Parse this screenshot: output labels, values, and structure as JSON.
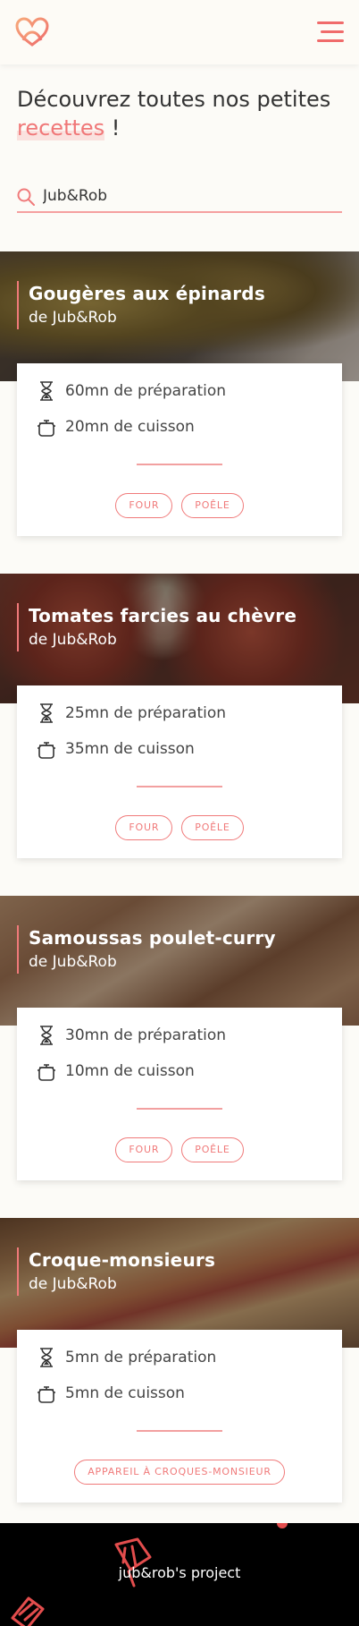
{
  "header": {
    "logo": "heart-logo-icon",
    "menu_icon": "hamburger-menu-icon"
  },
  "intro": {
    "text": "Découvrez toutes nos petites ",
    "highlight": "recettes",
    "suffix": " !"
  },
  "search": {
    "icon": "search-icon",
    "value": "Jub&Rob"
  },
  "recipes": [
    {
      "title": "Gougères aux épinards",
      "author": "de Jub&Rob",
      "prep": "60mn de préparation",
      "cook": "20mn de cuisson",
      "tags": [
        "Four",
        "Poêle"
      ]
    },
    {
      "title": "Tomates farcies au chèvre",
      "author": "de Jub&Rob",
      "prep": "25mn de préparation",
      "cook": "35mn de cuisson",
      "tags": [
        "Four",
        "Poêle"
      ]
    },
    {
      "title": "Samoussas poulet-curry",
      "author": "de Jub&Rob",
      "prep": "30mn de préparation",
      "cook": "10mn de cuisson",
      "tags": [
        "Four",
        "Poêle"
      ]
    },
    {
      "title": "Croque-monsieurs",
      "author": "de Jub&Rob",
      "prep": "5mn de préparation",
      "cook": "5mn de cuisson",
      "tags": [
        "Appareil à croques-monsieur"
      ]
    }
  ],
  "icons": {
    "prep": "hourglass-icon",
    "cook": "pot-icon"
  },
  "footer": {
    "brand": "jub&rob's project"
  },
  "colors": {
    "accent": "#f07a7a",
    "background": "#fcfbf7",
    "footer": "#000000"
  }
}
